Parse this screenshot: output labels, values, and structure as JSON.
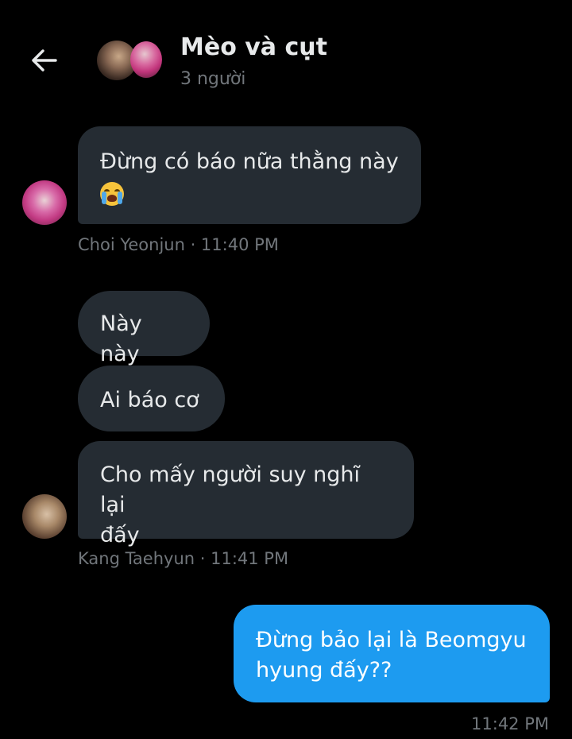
{
  "header": {
    "back_icon": "arrow-left-icon",
    "title": "Mèo và cụt",
    "subtitle": "3 người"
  },
  "messages": [
    {
      "sender": "Choi Yeonjun",
      "lines": [
        "Đừng có báo nữa thằng này"
      ],
      "emoji": "loudly-crying-face",
      "meta": "Choi Yeonjun · 11:40 PM"
    },
    {
      "sender": "Kang Taehyun",
      "lines": [
        "Này này"
      ]
    },
    {
      "sender": "Kang Taehyun",
      "lines": [
        "Ai báo cơ"
      ]
    },
    {
      "sender": "Kang Taehyun",
      "lines": [
        "Cho mấy người suy nghĩ lại",
        "đấy"
      ],
      "meta": "Kang Taehyun · 11:41 PM"
    },
    {
      "sender": "me",
      "lines": [
        "Đừng bảo lại là Beomgyu",
        "hyung đấy??"
      ],
      "meta": "11:42 PM"
    }
  ],
  "colors": {
    "background": "#000000",
    "incoming_bubble": "#252c33",
    "outgoing_bubble": "#1d9bf0",
    "text": "#e7e9ea",
    "meta": "#71767b"
  }
}
